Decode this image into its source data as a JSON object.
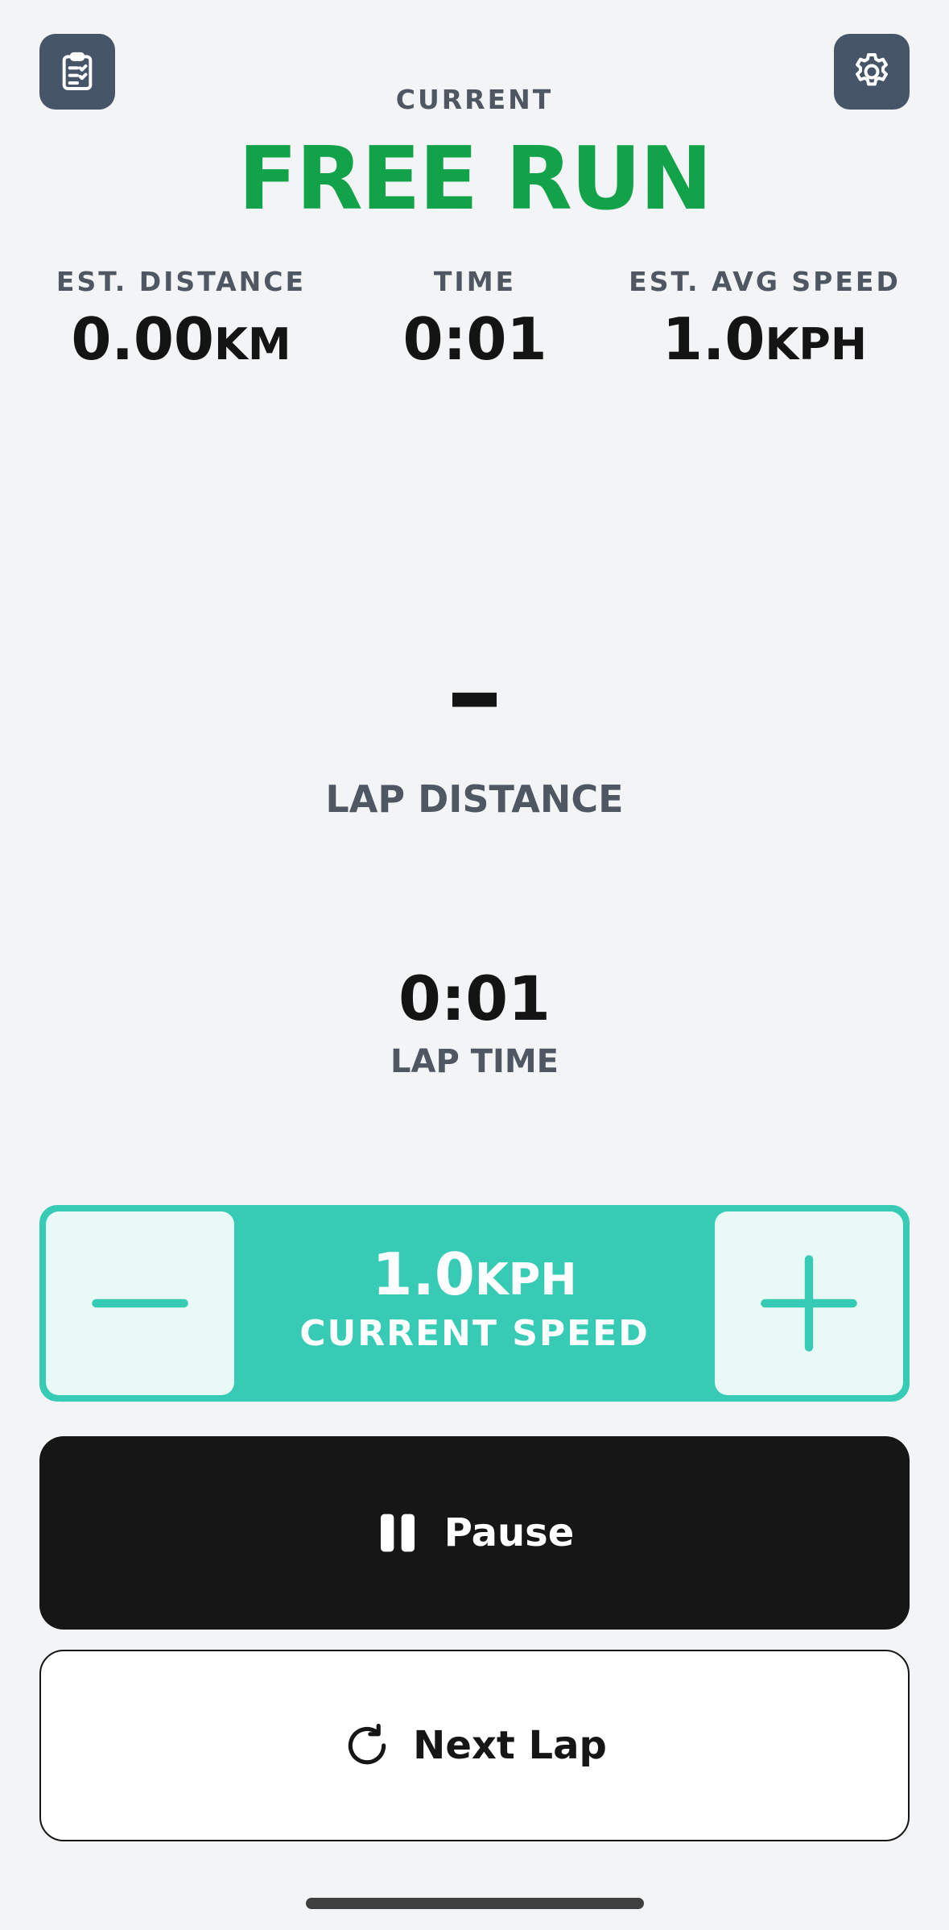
{
  "header": {
    "left_icon": "clipboard-checklist-icon",
    "right_icon": "gear-icon",
    "current_label": "CURRENT",
    "mode_title": "FREE RUN"
  },
  "stats": {
    "distance": {
      "label": "EST. DISTANCE",
      "value": "0.00",
      "unit": "KM"
    },
    "time": {
      "label": "TIME",
      "value": "0:01"
    },
    "avg_speed": {
      "label": "EST. AVG SPEED",
      "value": "1.0",
      "unit": "KPH"
    }
  },
  "lap": {
    "distance_value": "–",
    "distance_label": "LAP DISTANCE",
    "time_value": "0:01",
    "time_label": "LAP TIME"
  },
  "speed_control": {
    "value": "1.0",
    "unit": "KPH",
    "label": "CURRENT SPEED",
    "decrease_icon": "minus-icon",
    "increase_icon": "plus-icon"
  },
  "buttons": {
    "pause_label": "Pause",
    "pause_icon": "pause-icon",
    "next_lap_label": "Next Lap",
    "next_lap_icon": "refresh-icon"
  },
  "colors": {
    "accent": "#12a34a",
    "teal": "#37cbb6",
    "icon_button": "#465568"
  }
}
